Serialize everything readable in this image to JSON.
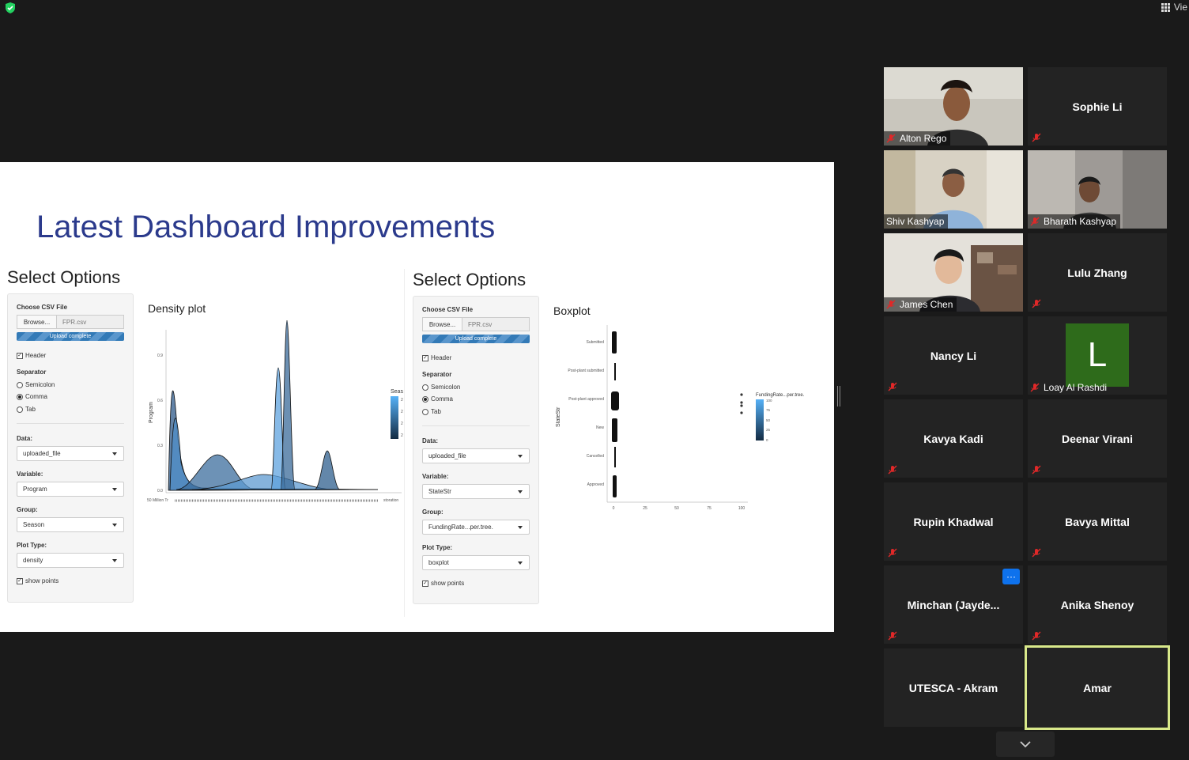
{
  "topbar": {
    "view_label": "Vie"
  },
  "slide": {
    "title": "Latest Dashboard Improvements",
    "left_panel": {
      "options_title": "Select Options",
      "choose_label": "Choose CSV File",
      "browse_label": "Browse...",
      "file_name": "FPR.csv",
      "upload_status": "Upload complete",
      "header_label": "Header",
      "separator_label": "Separator",
      "separators": [
        "Semicolon",
        "Comma",
        "Tab"
      ],
      "data_label": "Data:",
      "data_value": "uploaded_file",
      "variable_label": "Variable:",
      "variable_value": "Program",
      "group_label": "Group:",
      "group_value": "Season",
      "plot_type_label": "Plot Type:",
      "plot_type_value": "density",
      "show_points_label": "show points",
      "plot_title": "Density plot",
      "y_axis_label": "Program",
      "y_ticks": [
        "0.9",
        "0.6",
        "0.3",
        "0.0"
      ],
      "legend_title": "Seas",
      "legend_ticks": [
        "2",
        "2",
        "2",
        "2"
      ],
      "x_first_tick": "50 Million Tr",
      "x_last_tick": "storation"
    },
    "right_panel": {
      "options_title": "Select Options",
      "choose_label": "Choose CSV File",
      "browse_label": "Browse...",
      "file_name": "FPR.csv",
      "upload_status": "Upload complete",
      "header_label": "Header",
      "separator_label": "Separator",
      "separators": [
        "Semicolon",
        "Comma",
        "Tab"
      ],
      "data_label": "Data:",
      "data_value": "uploaded_file",
      "variable_label": "Variable:",
      "variable_value": "StateStr",
      "group_label": "Group:",
      "group_value": "FundingRate...per.tree.",
      "plot_type_label": "Plot Type:",
      "plot_type_value": "boxplot",
      "show_points_label": "show points",
      "plot_title": "Boxplot",
      "y_axis_label": "StateStr",
      "categories": [
        "Submitted",
        "Post-plant submitted",
        "Post-plant approved",
        "New",
        "Cancelled",
        "Approved"
      ],
      "x_ticks": [
        "0",
        "25",
        "50",
        "75",
        "100"
      ],
      "legend_title": "FundingRate...per.tree.",
      "legend_ticks": [
        "100",
        "75",
        "50",
        "25",
        "0"
      ]
    }
  },
  "participants": [
    {
      "name": "Alton Rego",
      "video": true
    },
    {
      "name": "Sophie Li",
      "video": false
    },
    {
      "name": "Shiv Kashyap",
      "video": true
    },
    {
      "name": "Bharath Kashyap",
      "video": true
    },
    {
      "name": "James Chen",
      "video": true
    },
    {
      "name": "Lulu Zhang",
      "video": false
    },
    {
      "name": "Nancy Li",
      "video": false
    },
    {
      "name": "Loay Al Rashdi",
      "video": false,
      "avatar_letter": "L"
    },
    {
      "name": "Kavya Kadi",
      "video": false
    },
    {
      "name": "Deenar Virani",
      "video": false
    },
    {
      "name": "Rupin Khadwal",
      "video": false
    },
    {
      "name": "Bavya Mittal",
      "video": false
    },
    {
      "name": "Minchan  (Jayde...",
      "video": false
    },
    {
      "name": "Anika Shenoy",
      "video": false
    },
    {
      "name": "UTESCA - Akram",
      "video": false
    },
    {
      "name": "Amar",
      "video": false
    }
  ],
  "colors": {
    "accent": "#0e72ed",
    "active_speaker": "#d8e88a",
    "title_blue": "#2b3a8c",
    "avatar_green": "#2e6b1b"
  }
}
